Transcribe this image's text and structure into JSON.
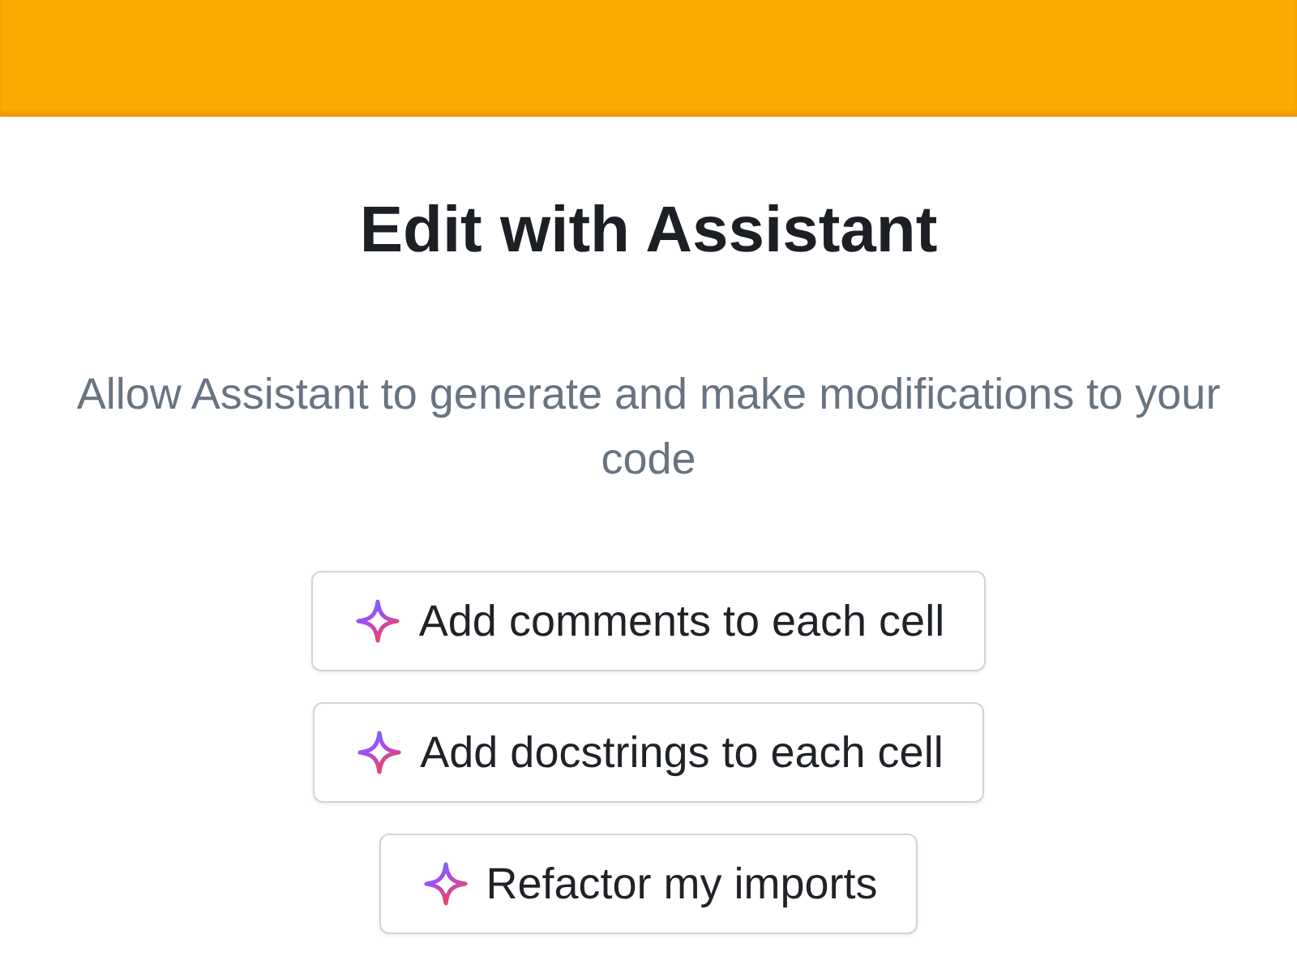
{
  "dialog": {
    "title": "Edit with Assistant",
    "description": "Allow Assistant to generate and make modifications to your code"
  },
  "actions": [
    {
      "label": "Add comments to each cell"
    },
    {
      "label": "Add docstrings to each cell"
    },
    {
      "label": "Refactor my imports"
    }
  ]
}
